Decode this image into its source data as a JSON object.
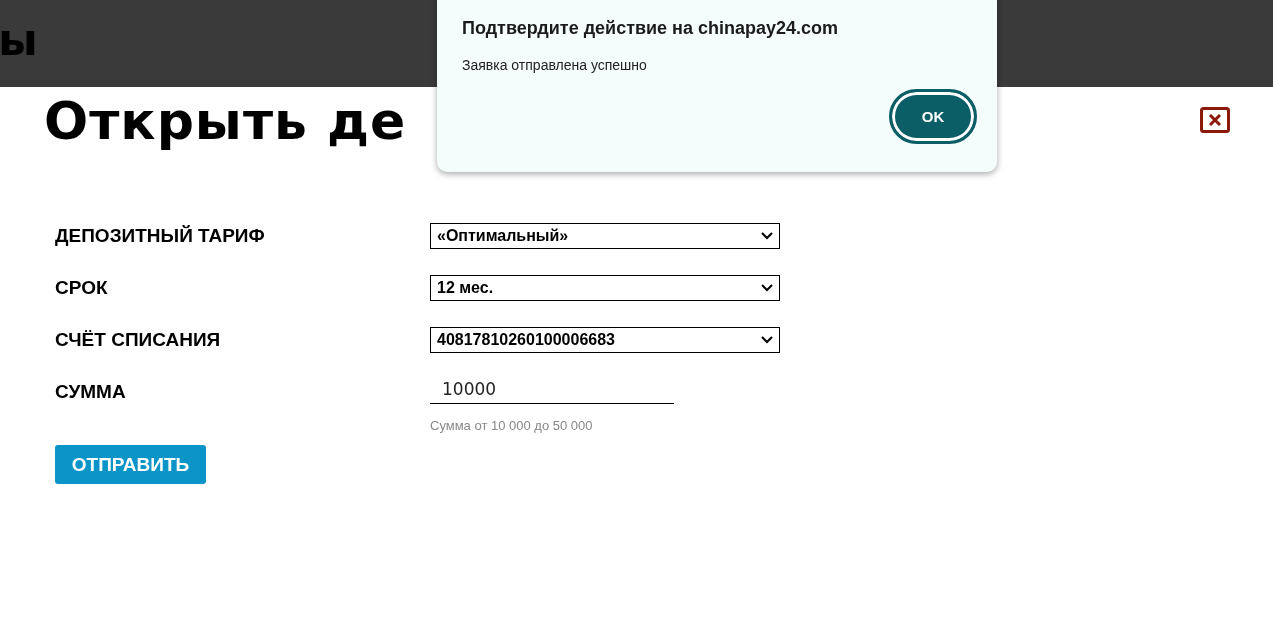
{
  "background_header": {
    "title_fragment": "ы"
  },
  "modal": {
    "title": "Открыть де",
    "fields": [
      {
        "kind": "select",
        "label": "ДЕПОЗИТНЫЙ ТАРИФ",
        "value": "«Оптимальный»"
      },
      {
        "kind": "select",
        "label": "СРОК",
        "value": "12 мес."
      },
      {
        "kind": "select",
        "label": "СЧЁТ СПИСАНИЯ",
        "value": "40817810260100006683"
      },
      {
        "kind": "input",
        "label": "СУММА",
        "value": "10000",
        "hint": "Сумма от 10 000 до 50 000"
      }
    ],
    "submit": "ОТПРАВИТЬ"
  },
  "dialog": {
    "title": "Подтвердите действие на chinapay24.com",
    "message": "Заявка отправлена успешно",
    "button": "OK"
  }
}
